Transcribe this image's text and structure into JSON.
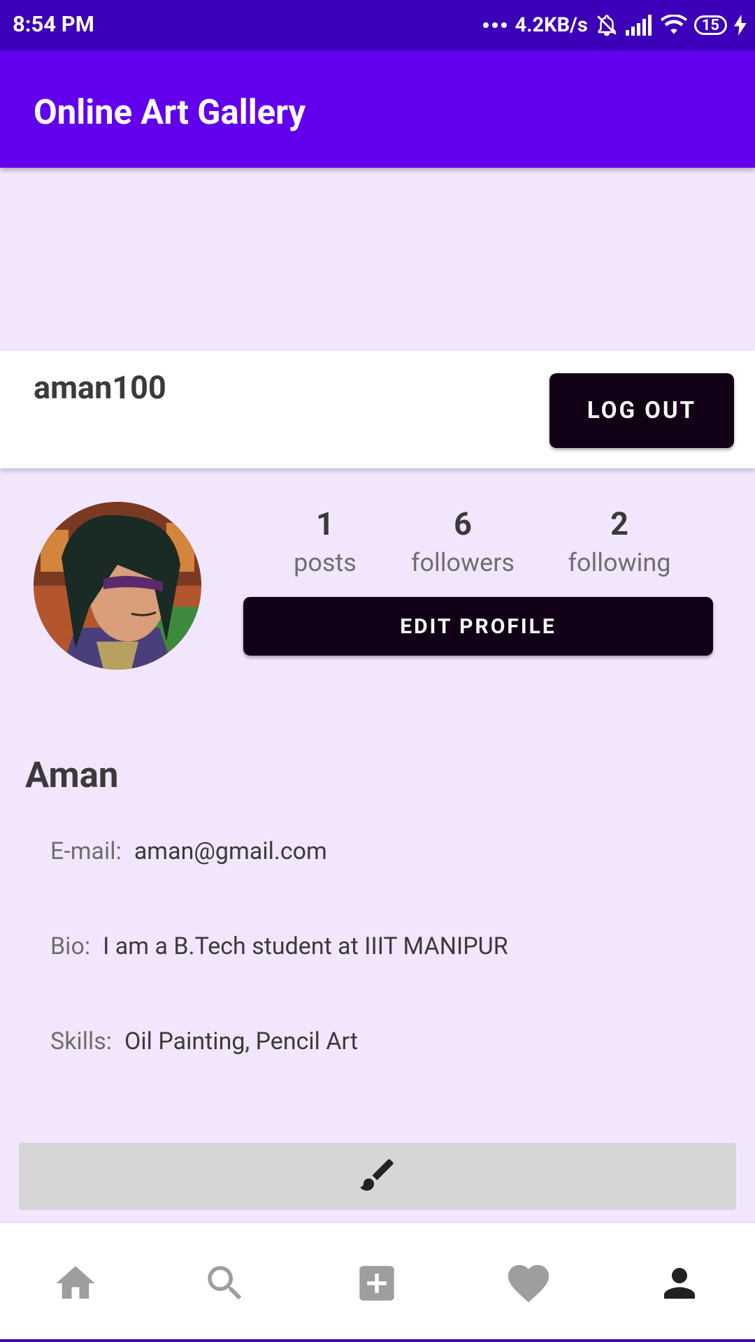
{
  "status_bar": {
    "time": "8:54 PM",
    "network_speed": "4.2KB/s",
    "battery": "15",
    "icons": [
      "more-dots-icon",
      "bell-off-icon",
      "signal-icon",
      "wifi-icon",
      "battery-icon",
      "charging-icon"
    ]
  },
  "app_bar": {
    "title": "Online Art Gallery"
  },
  "user_card": {
    "username": "aman100",
    "logout_label": "LOG OUT"
  },
  "profile": {
    "avatar_icon": "avatar-image",
    "stats": {
      "posts": {
        "value": "1",
        "label": "posts"
      },
      "followers": {
        "value": "6",
        "label": "followers"
      },
      "following": {
        "value": "2",
        "label": "following"
      }
    },
    "edit_label": "EDIT PROFILE",
    "name": "Aman",
    "email": {
      "label": "E-mail:",
      "value": "aman@gmail.com"
    },
    "bio": {
      "label": "Bio:",
      "value": "I am a B.Tech student at IIIT MANIPUR"
    },
    "skills": {
      "label": "Skills:",
      "value": "Oil Painting, Pencil Art"
    }
  },
  "art_tab": {
    "icon": "paint-brush-icon"
  },
  "bottom_nav": {
    "items": [
      {
        "icon": "home-icon",
        "active": false
      },
      {
        "icon": "search-icon",
        "active": false
      },
      {
        "icon": "add-box-icon",
        "active": false
      },
      {
        "icon": "heart-icon",
        "active": false
      },
      {
        "icon": "person-icon",
        "active": true
      }
    ]
  },
  "colors": {
    "status_bar": "#3b00b8",
    "app_bar": "#6200ee",
    "background": "#f2e6fd",
    "button": "#120017",
    "nav_inactive": "#9e9e9e",
    "nav_active": "#222222"
  }
}
